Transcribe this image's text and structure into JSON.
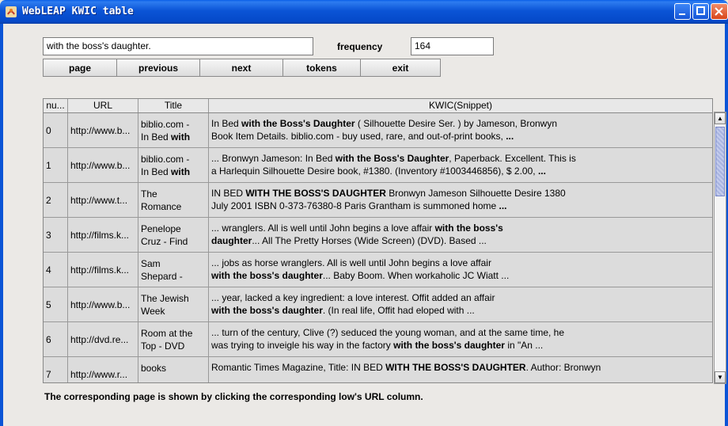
{
  "window": {
    "title": "WebLEAP KWIC table"
  },
  "search": {
    "value": "with the boss's daughter.",
    "frequency_label": "frequency",
    "frequency_value": "164"
  },
  "buttons": {
    "page": "page",
    "previous": "previous",
    "next": "next",
    "tokens": "tokens",
    "exit": "exit"
  },
  "table": {
    "headers": {
      "num": "nu...",
      "url": "URL",
      "title": "Title",
      "kwic": "KWIC(Snippet)"
    },
    "rows": [
      {
        "num": "0",
        "url": "http://www.b...",
        "title1": "biblio.com -",
        "title2_pre": "In Bed ",
        "title2_bold": "with",
        "l1_pre": "In Bed ",
        "l1_bold": "with the Boss's Daughter",
        "l1_post": " ( Silhouette Desire Ser. ) by Jameson, Bronwyn",
        "l2_pre": "Book Item Details. biblio.com - buy used, rare, and out-of-print books, ",
        "l2_bold": "...",
        "l2_post": ""
      },
      {
        "num": "1",
        "url": "http://www.b...",
        "title1": "biblio.com -",
        "title2_pre": "In Bed ",
        "title2_bold": "with",
        "l1_pre": "... Bronwyn Jameson: In Bed ",
        "l1_bold": "with the Boss's Daughter",
        "l1_post": ", Paperback. Excellent. This is",
        "l2_pre": "a Harlequin Silhouette Desire book, #1380. (Inventory #1003446856), $ 2.00, ",
        "l2_bold": "...",
        "l2_post": ""
      },
      {
        "num": "2",
        "url": "http://www.t...",
        "title1": "The",
        "title2_pre": "Romance",
        "title2_bold": "",
        "l1_pre": "IN BED ",
        "l1_bold": "WITH THE BOSS'S DAUGHTER",
        "l1_post": " Bronwyn Jameson Silhouette Desire 1380",
        "l2_pre": "July 2001 ISBN 0-373-76380-8 Paris Grantham is summoned home ",
        "l2_bold": "...",
        "l2_post": ""
      },
      {
        "num": "3",
        "url": "http://films.k...",
        "title1": "Penelope",
        "title2_pre": "Cruz - Find",
        "title2_bold": "",
        "l1_pre": "... wranglers. All is well until John begins a love affair ",
        "l1_bold": "with the boss's",
        "l1_post": "",
        "l2_pre": "",
        "l2_bold": "daughter",
        "l2_post": "... All The Pretty Horses (Wide Screen) (DVD). Based ..."
      },
      {
        "num": "4",
        "url": "http://films.k...",
        "title1": "Sam",
        "title2_pre": "Shepard -",
        "title2_bold": "",
        "l1_pre": "... jobs as horse wranglers. All is well until John begins a love affair",
        "l1_bold": "",
        "l1_post": "",
        "l2_pre": "",
        "l2_bold": "with the boss's daughter",
        "l2_post": "... Baby Boom. When workaholic JC Wiatt ..."
      },
      {
        "num": "5",
        "url": "http://www.b...",
        "title1": "The Jewish",
        "title2_pre": "Week",
        "title2_bold": "",
        "l1_pre": "... year, lacked a key ingredient: a love interest. Offit added an affair",
        "l1_bold": "",
        "l1_post": "",
        "l2_pre": "",
        "l2_bold": "with the boss's daughter",
        "l2_post": ". (In real life, Offit had eloped with ..."
      },
      {
        "num": "6",
        "url": "http://dvd.re...",
        "title1": "Room at the",
        "title2_pre": "Top - DVD",
        "title2_bold": "",
        "l1_pre": "... turn of the century, Clive (?) seduced the young woman, and at the same time, he",
        "l1_bold": "",
        "l1_post": "",
        "l2_pre": "was trying to inveigle his way in the factory ",
        "l2_bold": "with the boss's daughter",
        "l2_post": " in \"An ..."
      },
      {
        "num": "7",
        "url": "http://www.r...",
        "title1": "books",
        "title2_pre": "",
        "title2_bold": "",
        "l1_pre": "Romantic Times Magazine, Title: IN BED ",
        "l1_bold": "WITH THE BOSS'S DAUGHTER",
        "l1_post": ". Author: Bronwyn",
        "l2_pre": "",
        "l2_bold": "",
        "l2_post": ""
      }
    ]
  },
  "footer": {
    "text": "The corresponding page is shown by clicking the corresponding low's URL column."
  },
  "colors": {
    "titlebar": "#0b54d6",
    "row_bg": "#dcdcdc",
    "scroll_thumb": "#a8b4e0"
  }
}
